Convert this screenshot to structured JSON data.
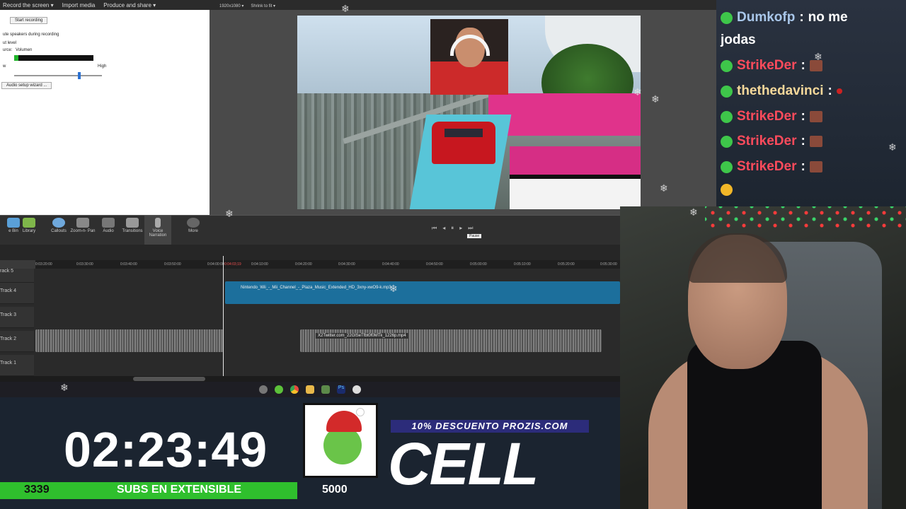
{
  "editor": {
    "menu": [
      "Record the screen ▾",
      "Import media",
      "Produce and share ▾"
    ],
    "canvas_toolbar": [
      "1920x1080 ▾",
      "Shrink to fit ▾"
    ],
    "recording_panel": {
      "start_button": "Start recording",
      "mute_option": "ute speakers during recording",
      "input_level_label": "ut level",
      "source_label": "urce:",
      "source_value": "Volumen",
      "low_label": "w",
      "high_label": "High",
      "audio_wizard_button": "Audio setup wizard ..."
    },
    "tools": [
      "e Bin",
      "Library",
      "Callouts",
      "Zoom-n-\nPan",
      "Audio",
      "Transitions",
      "Voice\nNarration",
      "More"
    ],
    "tooltip": "Pause",
    "ruler_ticks": [
      "0:03:20:00",
      "0:03:30:00",
      "0:03:40:00",
      "0:03:50:00",
      "0:04:00:00",
      "0:04:03;19",
      "0:04:10:00",
      "0:04:20:00",
      "0:04:30:00",
      "0:04:40:00",
      "0:04:50:00",
      "0:05:00:00",
      "0:05:10:00",
      "0:05:20:00",
      "0:05:30:00"
    ],
    "tracks": [
      "rack 5",
      "Track 4",
      "Track 3",
      "Track 2",
      "Track 1"
    ],
    "clips": {
      "music": "Nintendo_Wii_-_Mii_Channel_-_Plaza_Music_Extended_HD_3xny-xwO9-k.mp3",
      "video": "X2Twitter.com_22GlSeTfbt0f0MTk_1226p.mp4"
    }
  },
  "chat": [
    {
      "user": "Dumkofp",
      "text": "no me",
      "cont": "jodas",
      "color": "#a9c7ea"
    },
    {
      "user": "StrikeDer",
      "text": "",
      "color": "#ff4b5c"
    },
    {
      "user": "thethedavinci",
      "text": "",
      "color": "#f5d89a"
    },
    {
      "user": "StrikeDer",
      "text": "",
      "color": "#ff4b5c"
    },
    {
      "user": "StrikeDer",
      "text": "",
      "color": "#ff4b5c"
    },
    {
      "user": "StrikeDer",
      "text": "",
      "color": "#ff4b5c"
    }
  ],
  "overlay": {
    "timer": "02:23:49",
    "subs_count": "3339",
    "subs_label": "SUBS EN EXTENSIBLE",
    "subs_goal": "5000",
    "promo": "10% DESCUENTO PROZIS.COM",
    "brand": "CELL"
  },
  "colors": {
    "accent_green": "#2fbf2d",
    "promo_bg": "#2c2c7a",
    "timeline_clip": "#1c6f9c"
  }
}
